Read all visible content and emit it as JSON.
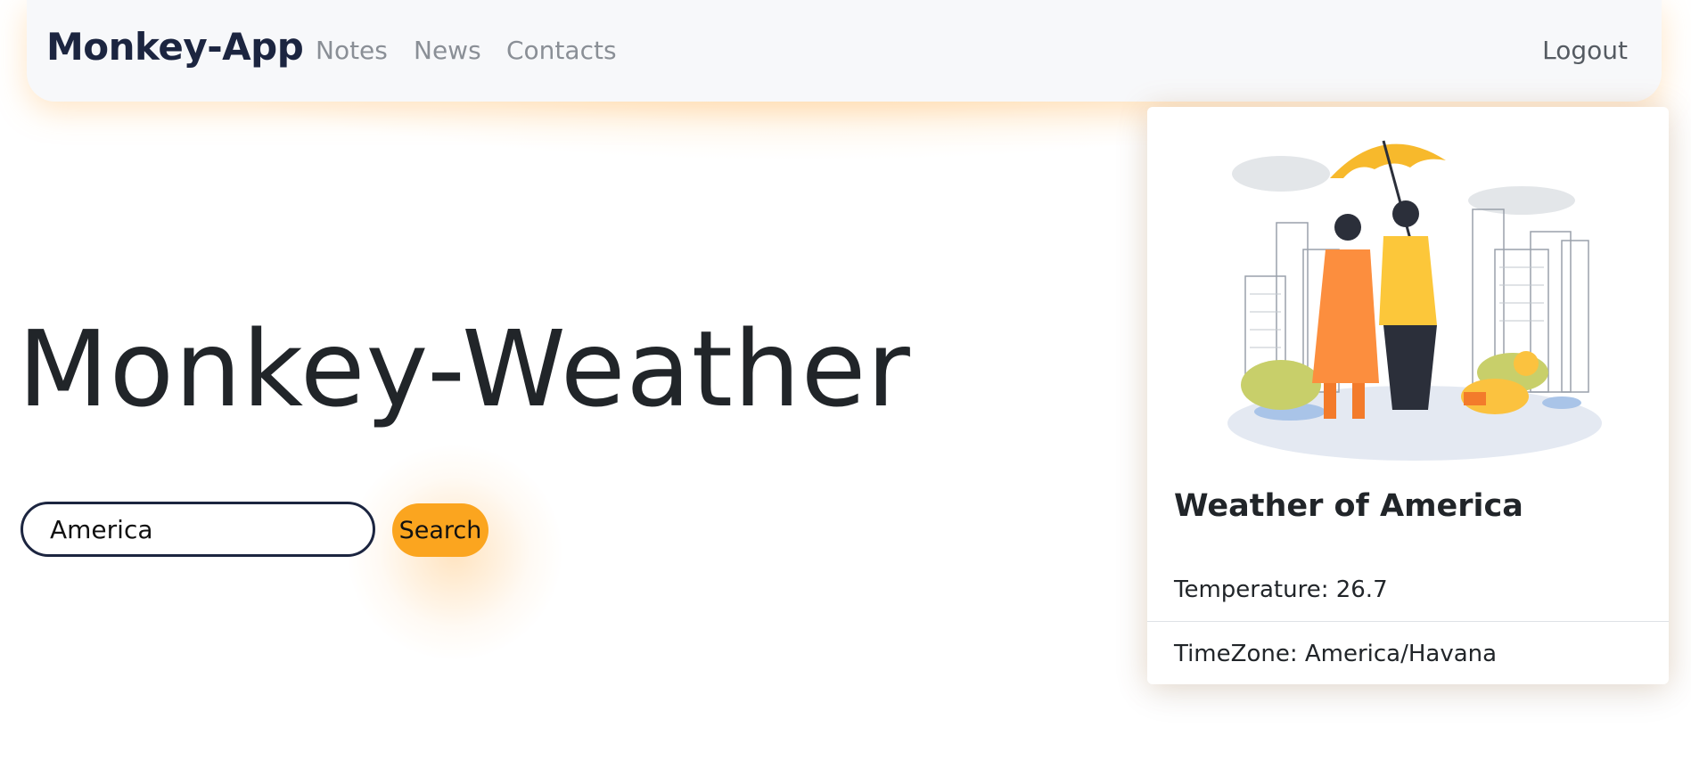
{
  "navbar": {
    "brand": "Monkey-App",
    "links": [
      {
        "label": "Notes"
      },
      {
        "label": "News"
      },
      {
        "label": "Contacts"
      }
    ],
    "logout_label": "Logout"
  },
  "hero": {
    "title": "Monkey-Weather"
  },
  "search": {
    "value": "America",
    "button_label": "Search"
  },
  "weather_card": {
    "title": "Weather of America",
    "temperature": "Temperature: 26.7",
    "timezone": "TimeZone: America/Havana"
  },
  "colors": {
    "brand": "#1c2540",
    "accent": "#fba51f",
    "navbar_bg": "#f7f8fa"
  }
}
